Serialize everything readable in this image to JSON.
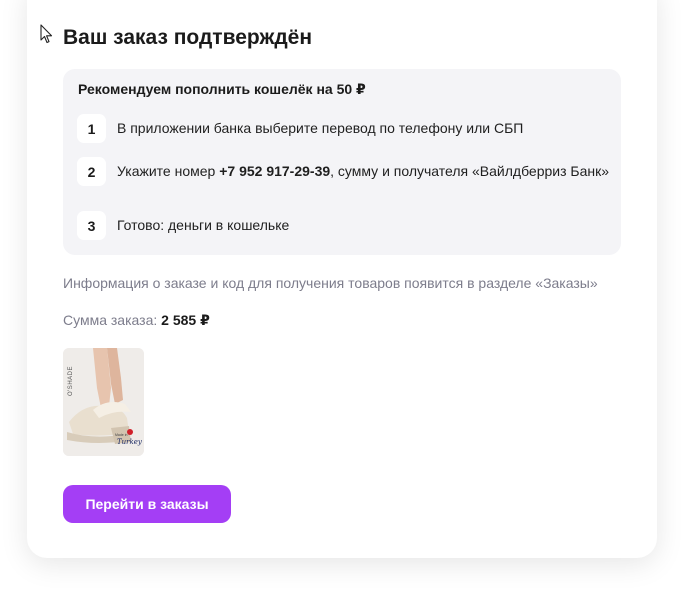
{
  "title": "Ваш заказ подтверждён",
  "recommend": {
    "title": "Рекомендуем пополнить кошелёк на 50 ₽",
    "steps": [
      {
        "num": "1",
        "text": "В приложении банка выберите перевод по телефону или СБП"
      },
      {
        "num": "2",
        "text_before": "Укажите номер ",
        "phone": "+7 952 917-29-39",
        "text_after": ", сумму и получателя «Вайлдберриз Банк»"
      },
      {
        "num": "3",
        "text": "Готово: деньги в кошельке"
      }
    ]
  },
  "info_text": "Информация о заказе и код для получения товаров появится в разделе «Заказы»",
  "order_sum": {
    "label": "Сумма заказа: ",
    "value": "2 585 ₽"
  },
  "product": {
    "brand_text": "O'SHADE",
    "flag_text": "Turkey",
    "flag_caption": "Made in"
  },
  "button_label": "Перейти в заказы",
  "colors": {
    "accent": "#a43ef5",
    "panel": "#f4f4f7",
    "muted": "#7d7d8c"
  },
  "icons": {
    "cursor": "arrow-cursor-icon"
  }
}
